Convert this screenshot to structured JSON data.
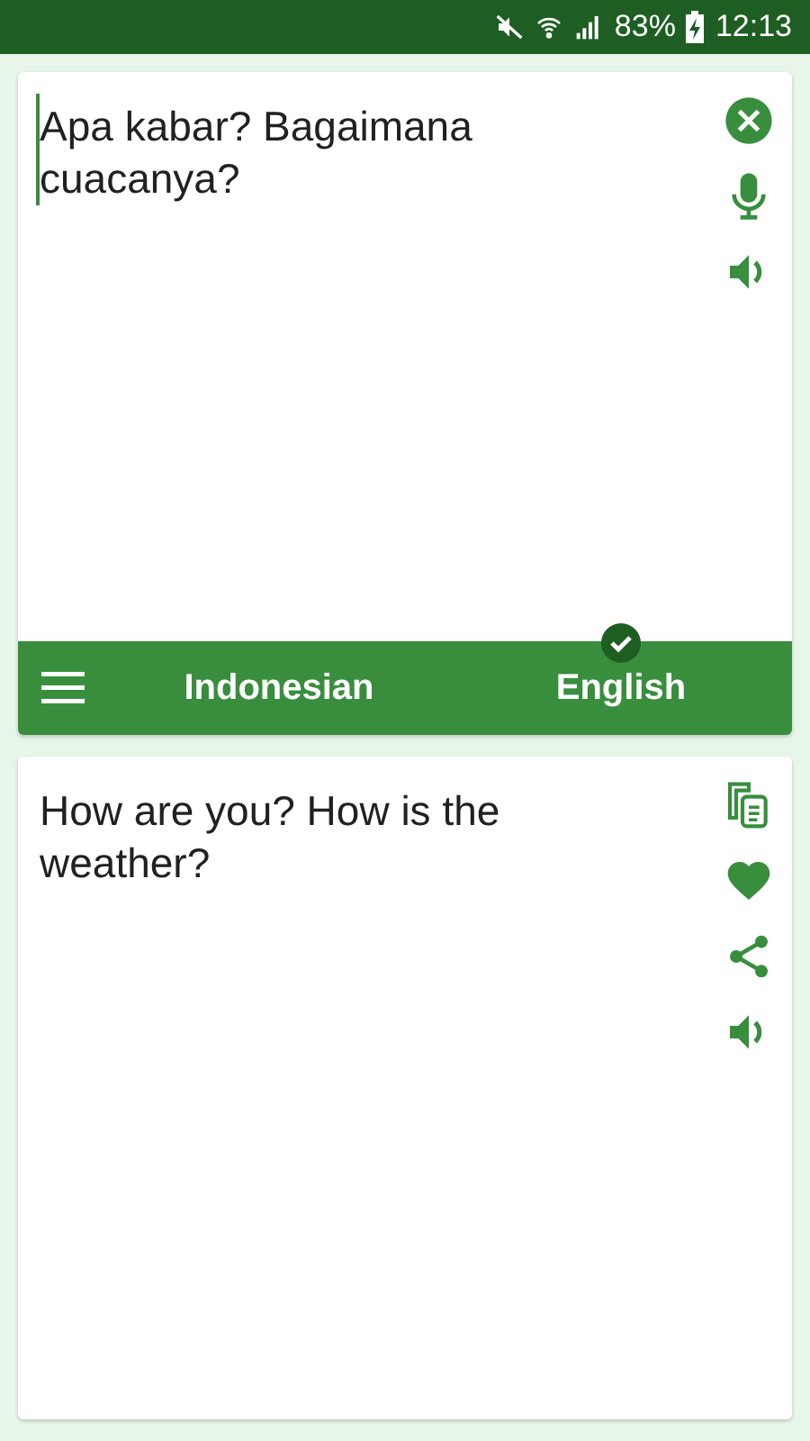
{
  "status_bar": {
    "battery": "83%",
    "time": "12:13"
  },
  "source": {
    "text": "Apa kabar? Bagaimana cuacanya?"
  },
  "languages": [
    {
      "label": "Indonesian",
      "selected": false
    },
    {
      "label": "English",
      "selected": true
    }
  ],
  "result": {
    "text": "How are you? How is the weather?"
  }
}
